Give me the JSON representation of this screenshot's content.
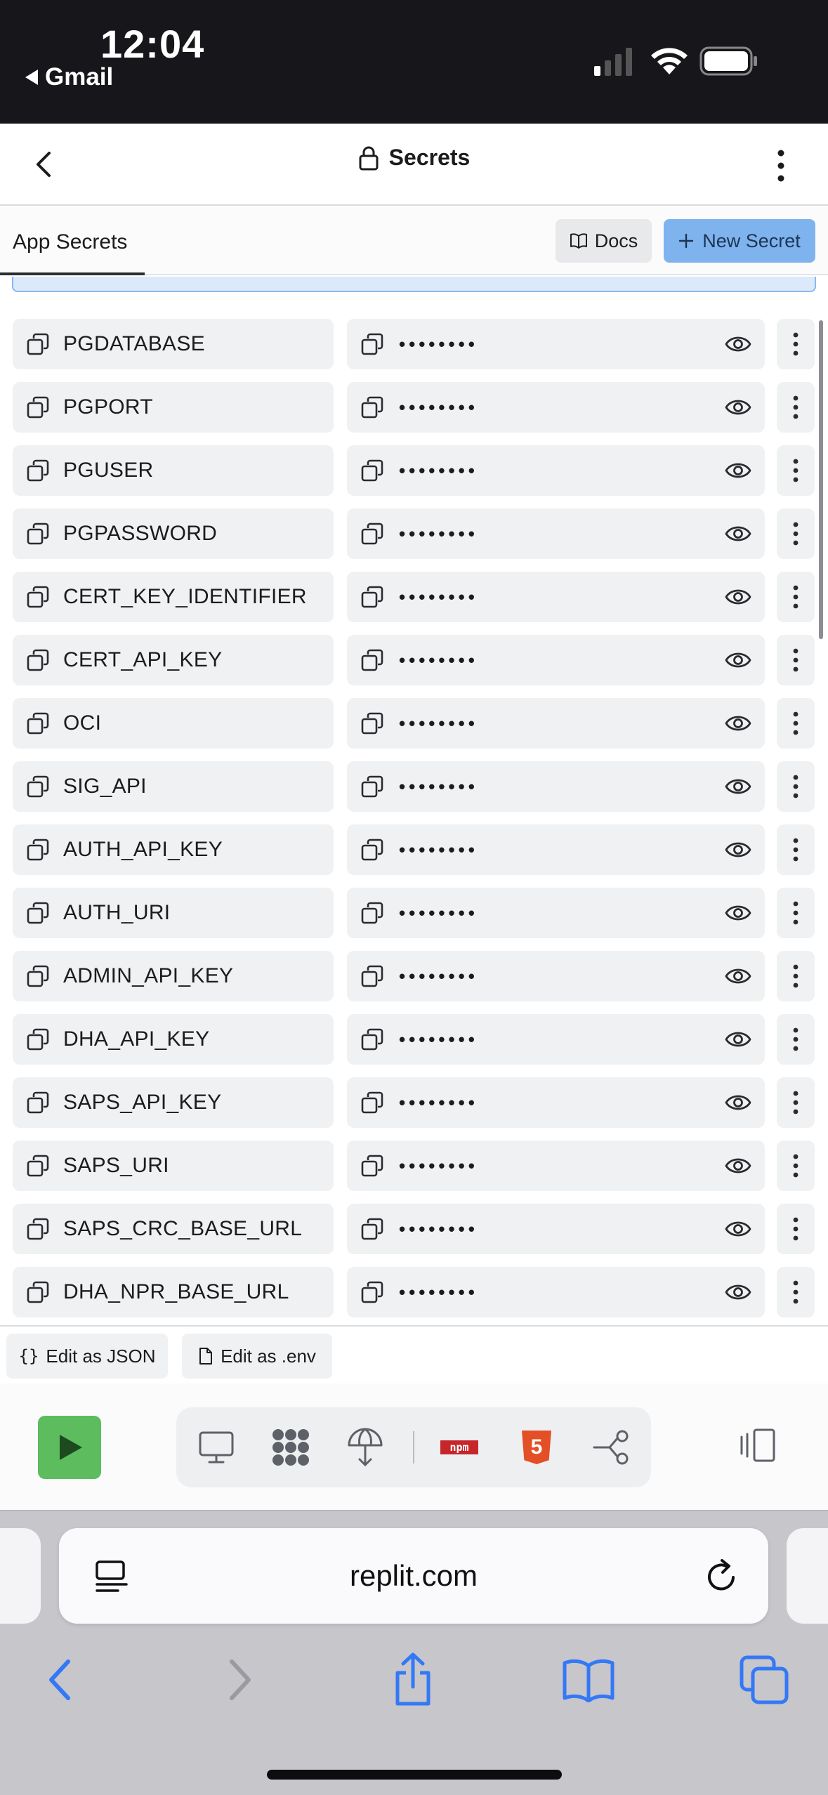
{
  "status_bar": {
    "time": "12:04",
    "back_app": "Gmail"
  },
  "header": {
    "title": "Secrets"
  },
  "toolbar": {
    "tab_label": "App Secrets",
    "docs_label": "Docs",
    "new_secret_label": "New Secret"
  },
  "secrets": [
    {
      "key": "PGDATABASE",
      "value": "••••••••"
    },
    {
      "key": "PGPORT",
      "value": "••••••••"
    },
    {
      "key": "PGUSER",
      "value": "••••••••"
    },
    {
      "key": "PGPASSWORD",
      "value": "••••••••"
    },
    {
      "key": "CERT_KEY_IDENTIFIER",
      "value": "••••••••"
    },
    {
      "key": "CERT_API_KEY",
      "value": "••••••••"
    },
    {
      "key": "OCI",
      "value": "••••••••"
    },
    {
      "key": "SIG_API",
      "value": "••••••••"
    },
    {
      "key": "AUTH_API_KEY",
      "value": "••••••••"
    },
    {
      "key": "AUTH_URI",
      "value": "••••••••"
    },
    {
      "key": "ADMIN_API_KEY",
      "value": "••••••••"
    },
    {
      "key": "DHA_API_KEY",
      "value": "••••••••"
    },
    {
      "key": "SAPS_API_KEY",
      "value": "••••••••"
    },
    {
      "key": "SAPS_URI",
      "value": "••••••••"
    },
    {
      "key": "SAPS_CRC_BASE_URL",
      "value": "••••••••"
    },
    {
      "key": "DHA_NPR_BASE_URL",
      "value": "••••••••"
    }
  ],
  "edit_bar": {
    "json_label": "Edit as JSON",
    "env_label": "Edit as .env",
    "json_glyph": "{}"
  },
  "tools": {
    "items": [
      "monitor-icon",
      "dots-grid-icon",
      "deploy-icon",
      "npm-icon",
      "html5-icon",
      "git-icon"
    ],
    "npm_text": "npm",
    "html5_text": "5",
    "run_color": "#5cbc5e"
  },
  "safari": {
    "url": "replit.com"
  },
  "colors": {
    "accent": "#7fb3ee",
    "safari_blue": "#3478f6"
  }
}
